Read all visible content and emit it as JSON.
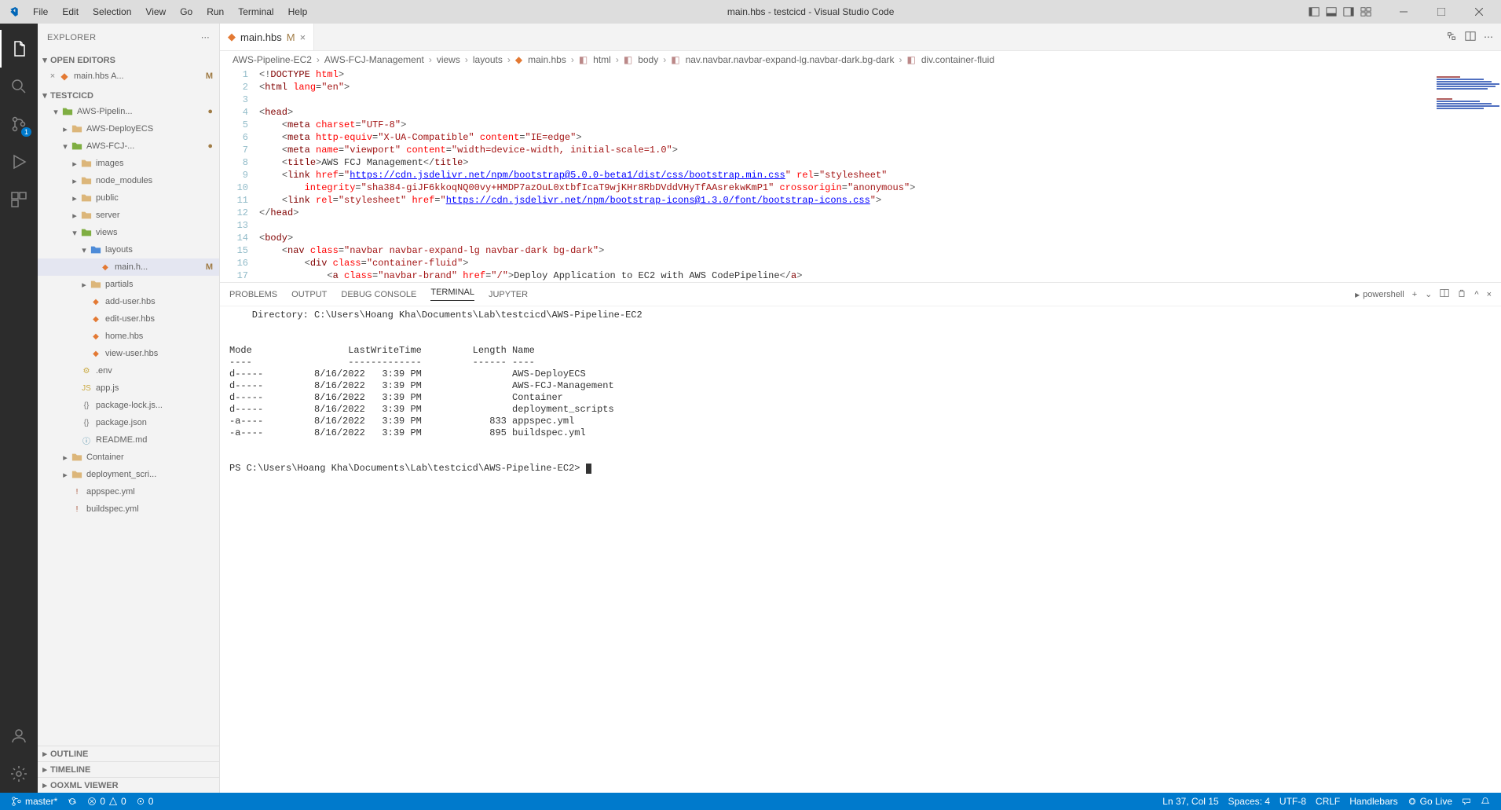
{
  "titlebar": {
    "menus": [
      "File",
      "Edit",
      "Selection",
      "View",
      "Go",
      "Run",
      "Terminal",
      "Help"
    ],
    "title": "main.hbs - testcicd - Visual Studio Code"
  },
  "activity": {
    "scm_badge": "1"
  },
  "sidebar": {
    "title": "EXPLORER",
    "open_editors_label": "OPEN EDITORS",
    "open_editors_item": "main.hbs  A...",
    "open_editors_badge": "M",
    "workspace": "TESTCICD",
    "outline": "OUTLINE",
    "timeline": "TIMELINE",
    "ooxml": "OOXML VIEWER",
    "tree": [
      {
        "depth": 1,
        "chev": "▾",
        "icon": "folder",
        "cls": "folder-green",
        "label": "AWS-Pipelin...",
        "badge": "●"
      },
      {
        "depth": 2,
        "chev": "▸",
        "icon": "folder",
        "cls": "folder-yellow",
        "label": "AWS-DeployECS"
      },
      {
        "depth": 2,
        "chev": "▾",
        "icon": "folder",
        "cls": "folder-green",
        "label": "AWS-FCJ-...",
        "badge": "●"
      },
      {
        "depth": 3,
        "chev": "▸",
        "icon": "folder",
        "cls": "folder-yellow",
        "label": "images"
      },
      {
        "depth": 3,
        "chev": "▸",
        "icon": "folder",
        "cls": "folder-yellow",
        "label": "node_modules"
      },
      {
        "depth": 3,
        "chev": "▸",
        "icon": "folder",
        "cls": "folder-yellow",
        "label": "public"
      },
      {
        "depth": 3,
        "chev": "▸",
        "icon": "folder",
        "cls": "folder-yellow",
        "label": "server"
      },
      {
        "depth": 3,
        "chev": "▾",
        "icon": "folder",
        "cls": "folder-green",
        "label": "views"
      },
      {
        "depth": 4,
        "chev": "▾",
        "icon": "folder",
        "cls": "folder-blue",
        "label": "layouts"
      },
      {
        "depth": 5,
        "chev": "",
        "icon": "hbs",
        "cls": "file-orange",
        "label": "main.h...",
        "badge": "M",
        "active": true
      },
      {
        "depth": 4,
        "chev": "▸",
        "icon": "folder",
        "cls": "folder-yellow",
        "label": "partials"
      },
      {
        "depth": 4,
        "chev": "",
        "icon": "hbs",
        "cls": "file-orange",
        "label": "add-user.hbs"
      },
      {
        "depth": 4,
        "chev": "",
        "icon": "hbs",
        "cls": "file-orange",
        "label": "edit-user.hbs"
      },
      {
        "depth": 4,
        "chev": "",
        "icon": "hbs",
        "cls": "file-orange",
        "label": "home.hbs"
      },
      {
        "depth": 4,
        "chev": "",
        "icon": "hbs",
        "cls": "file-orange",
        "label": "view-user.hbs"
      },
      {
        "depth": 3,
        "chev": "",
        "icon": "env",
        "cls": "file-yellow",
        "label": ".env"
      },
      {
        "depth": 3,
        "chev": "",
        "icon": "js",
        "cls": "file-yellow",
        "label": "app.js"
      },
      {
        "depth": 3,
        "chev": "",
        "icon": "json",
        "cls": "file-grey",
        "label": "package-lock.js..."
      },
      {
        "depth": 3,
        "chev": "",
        "icon": "json",
        "cls": "file-grey",
        "label": "package.json"
      },
      {
        "depth": 3,
        "chev": "",
        "icon": "md",
        "cls": "file-blue",
        "label": "README.md"
      },
      {
        "depth": 2,
        "chev": "▸",
        "icon": "folder",
        "cls": "folder-yellow",
        "label": "Container"
      },
      {
        "depth": 2,
        "chev": "▸",
        "icon": "folder",
        "cls": "folder-yellow",
        "label": "deployment_scri..."
      },
      {
        "depth": 2,
        "chev": "",
        "icon": "yml",
        "cls": "file-red",
        "label": "appspec.yml"
      },
      {
        "depth": 2,
        "chev": "",
        "icon": "yml",
        "cls": "file-red",
        "label": "buildspec.yml"
      }
    ]
  },
  "tabs": {
    "file_icon": "hbs",
    "file_label": "main.hbs",
    "file_badge": "M"
  },
  "breadcrumb": [
    "AWS-Pipeline-EC2",
    "AWS-FCJ-Management",
    "views",
    "layouts",
    "main.hbs",
    "html",
    "body",
    "nav.navbar.navbar-expand-lg.navbar-dark.bg-dark",
    "div.container-fluid"
  ],
  "code": {
    "lines": [
      {
        "n": 1,
        "html": "<span class='c-grey'>&lt;!</span><span class='c-red'>DOCTYPE</span> <span class='c-redattr'>html</span><span class='c-grey'>&gt;</span>"
      },
      {
        "n": 2,
        "html": "<span class='c-grey'>&lt;</span><span class='c-red'>html</span> <span class='c-redattr'>lang</span>=<span class='c-brown'>\"en\"</span><span class='c-grey'>&gt;</span>"
      },
      {
        "n": 3,
        "html": ""
      },
      {
        "n": 4,
        "html": "<span class='c-grey'>&lt;</span><span class='c-red'>head</span><span class='c-grey'>&gt;</span>"
      },
      {
        "n": 5,
        "html": "    <span class='c-grey'>&lt;</span><span class='c-red'>meta</span> <span class='c-redattr'>charset</span>=<span class='c-brown'>\"UTF-8\"</span><span class='c-grey'>&gt;</span>"
      },
      {
        "n": 6,
        "html": "    <span class='c-grey'>&lt;</span><span class='c-red'>meta</span> <span class='c-redattr'>http-equiv</span>=<span class='c-brown'>\"X-UA-Compatible\"</span> <span class='c-redattr'>content</span>=<span class='c-brown'>\"IE=edge\"</span><span class='c-grey'>&gt;</span>"
      },
      {
        "n": 7,
        "html": "    <span class='c-grey'>&lt;</span><span class='c-red'>meta</span> <span class='c-redattr'>name</span>=<span class='c-brown'>\"viewport\"</span> <span class='c-redattr'>content</span>=<span class='c-brown'>\"width=device-width, initial-scale=1.0\"</span><span class='c-grey'>&gt;</span>"
      },
      {
        "n": 8,
        "html": "    <span class='c-grey'>&lt;</span><span class='c-red'>title</span><span class='c-grey'>&gt;</span>AWS FCJ Management<span class='c-grey'>&lt;/</span><span class='c-red'>title</span><span class='c-grey'>&gt;</span>"
      },
      {
        "n": 9,
        "html": "    <span class='c-grey'>&lt;</span><span class='c-red'>link</span> <span class='c-redattr'>href</span>=<span class='c-brown'>\"</span><span class='c-link'>https://cdn.jsdelivr.net/npm/bootstrap@5.0.0-beta1/dist/css/bootstrap.min.css</span><span class='c-brown'>\"</span> <span class='c-redattr'>rel</span>=<span class='c-brown'>\"stylesheet\"</span>"
      },
      {
        "n": 10,
        "html": "        <span class='c-redattr'>integrity</span>=<span class='c-brown'>\"sha384-giJF6kkoqNQ00vy+HMDP7azOuL0xtbfIcaT9wjKHr8RbDVddVHyTfAAsrekwKmP1\"</span> <span class='c-redattr'>crossorigin</span>=<span class='c-brown'>\"anonymous\"</span><span class='c-grey'>&gt;</span>"
      },
      {
        "n": 11,
        "html": "    <span class='c-grey'>&lt;</span><span class='c-red'>link</span> <span class='c-redattr'>rel</span>=<span class='c-brown'>\"stylesheet\"</span> <span class='c-redattr'>href</span>=<span class='c-brown'>\"</span><span class='c-link'>https://cdn.jsdelivr.net/npm/bootstrap-icons@1.3.0/font/bootstrap-icons.css</span><span class='c-brown'>\"</span><span class='c-grey'>&gt;</span>"
      },
      {
        "n": 12,
        "html": "<span class='c-grey'>&lt;/</span><span class='c-red'>head</span><span class='c-grey'>&gt;</span>"
      },
      {
        "n": 13,
        "html": ""
      },
      {
        "n": 14,
        "html": "<span class='c-grey'>&lt;</span><span class='c-red'>body</span><span class='c-grey'>&gt;</span>"
      },
      {
        "n": 15,
        "html": "    <span class='c-grey'>&lt;</span><span class='c-red'>nav</span> <span class='c-redattr'>class</span>=<span class='c-brown'>\"navbar navbar-expand-lg navbar-dark bg-dark\"</span><span class='c-grey'>&gt;</span>"
      },
      {
        "n": 16,
        "html": "        <span class='c-grey'>&lt;</span><span class='c-red'>div</span> <span class='c-redattr'>class</span>=<span class='c-brown'>\"container-fluid\"</span><span class='c-grey'>&gt;</span>"
      },
      {
        "n": 17,
        "html": "            <span class='c-grey'>&lt;</span><span class='c-red'>a</span> <span class='c-redattr'>class</span>=<span class='c-brown'>\"navbar-brand\"</span> <span class='c-redattr'>href</span>=<span class='c-brown'>\"/\"</span><span class='c-grey'>&gt;</span>Deploy Application to EC2 with AWS CodePipeline<span class='c-grey'>&lt;/</span><span class='c-red'>a</span><span class='c-grey'>&gt;</span>"
      }
    ]
  },
  "panel": {
    "tabs": [
      "PROBLEMS",
      "OUTPUT",
      "DEBUG CONSOLE",
      "TERMINAL",
      "JUPYTER"
    ],
    "active_tab": "TERMINAL",
    "shell_label": "powershell",
    "terminal_text": "    Directory: C:\\Users\\Hoang Kha\\Documents\\Lab\\testcicd\\AWS-Pipeline-EC2\n\n\nMode                 LastWriteTime         Length Name\n----                 -------------         ------ ----\nd-----         8/16/2022   3:39 PM                AWS-DeployECS\nd-----         8/16/2022   3:39 PM                AWS-FCJ-Management\nd-----         8/16/2022   3:39 PM                Container\nd-----         8/16/2022   3:39 PM                deployment_scripts\n-a----         8/16/2022   3:39 PM            833 appspec.yml\n-a----         8/16/2022   3:39 PM            895 buildspec.yml\n\n\n",
    "prompt": "PS C:\\Users\\Hoang Kha\\Documents\\Lab\\testcicd\\AWS-Pipeline-EC2> "
  },
  "status": {
    "branch": "master*",
    "sync": "",
    "errors": "0",
    "warnings": "0",
    "port": "0",
    "ln_col": "Ln 37, Col 15",
    "spaces": "Spaces: 4",
    "encoding": "UTF-8",
    "eol": "CRLF",
    "lang": "Handlebars",
    "golive": "Go Live"
  }
}
